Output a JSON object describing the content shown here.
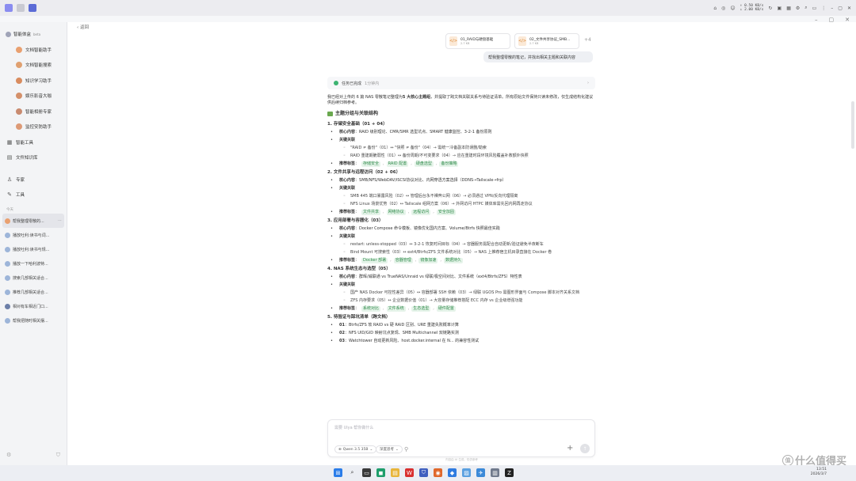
{
  "topbar": {
    "speed_up": "↑ 0.50 KB/s",
    "speed_down": "↓ 2.00 KB/s"
  },
  "sidebar": {
    "app_name": "智能体盒",
    "beta": "beta",
    "agents": [
      {
        "label": "文档智能助手"
      },
      {
        "label": "文档智能搜索"
      },
      {
        "label": "知识学习助手"
      },
      {
        "label": "娱乐影音大咖"
      },
      {
        "label": "智能相册专家"
      },
      {
        "label": "监控安防助手"
      }
    ],
    "tools": [
      {
        "label": "智能工具",
        "icon": "grid-icon"
      },
      {
        "label": "文件知识库",
        "icon": "folder-icon"
      }
    ],
    "more": [
      {
        "label": "专家",
        "icon": "person-icon"
      },
      {
        "label": "工具",
        "icon": "wrench-icon"
      }
    ],
    "history_label": "今天",
    "history": [
      {
        "label": "帮我整理零散的..."
      },
      {
        "label": "播放吐利:读书与词..."
      },
      {
        "label": "播放吐利:读书与规..."
      },
      {
        "label": "播放一下哈利波特..."
      },
      {
        "label": "搜索几部相关适合..."
      },
      {
        "label": "推荐几部相关适合..."
      },
      {
        "label": "相对有车相近门口..."
      },
      {
        "label": "帮我把随时相关摆..."
      }
    ]
  },
  "main": {
    "back_label": "返回",
    "attachments": [
      {
        "name": "01_RAID与硬盘基础",
        "size": "2.7 KB"
      },
      {
        "name": "02_文件共享协议_SMB...",
        "size": "2.7 KB"
      }
    ],
    "attach_more": "+4",
    "user_message": "帮我整理零散的笔记，并找出相关主题和关联内容",
    "task_status": "任务已完成",
    "task_time": "1分钟内",
    "intro_pre": "我已经对上传的 6 篇 NAS 零散笔记整理为",
    "intro_bold": "5 大核心主题组",
    "intro_post": "，并提取了跨文档关联关系与待验证清单。所有原始文件保持只读未修改，仅生成结构化建议供后续归档参考。",
    "section_title": "主题分组与关联结构",
    "groups": [
      {
        "title": "1. 存储安全基础（01 + 04）",
        "core_label": "核心内容",
        "core": "：RAID 级别理论、CMR/SMR 选型坑点、SMART 健康监控、3-2-1 备份原则",
        "rel_label": "关键关联",
        "rels": [
          "\"RAID ≠ 备份\"（01）↔ \"快照 ≠ 备份\"（04）→ 需统一冷备副本防误删/勒索",
          "RAID 重建期脆弱性（01）↔ 备份周期/不可变要求（04）→ 应在重建时段环境风险覆盖补救额外快照"
        ],
        "tags_label": "推荐标签",
        "tags": [
          "存储安全",
          "RAID 配置",
          "硬盘选型",
          "备份策略"
        ]
      },
      {
        "title": "2. 文件共享与远程访问（02 + 06）",
        "core_label": "核心内容",
        "core": "：SMB/NFS/WebDAV/iSCSI协议对比、内网穿透方案选择（DDNS→Tailscale→frp）",
        "rel_label": "关键关联",
        "rels": [
          "SMB 445 端口暴露风险（02）↔ 管理后台永不裸奔公网（06）→ 必须通过 VPN/反向代理隔离",
          "NFS Linux 场景优势（02）↔ Tailscale 组网方案（06）→ 外网访问 HTPC 媒体库需先回内网再走协议"
        ],
        "tags_label": "推荐标签",
        "tags": [
          "文件共享",
          "网络协议",
          "远程访问",
          "安全加固"
        ]
      },
      {
        "title": "3. 应用部署与容器化（03）",
        "core_label": "核心内容",
        "core": "：Docker Compose 命令模板、镜像优化国内方案、Volume/Btrfs 快照最佳实践",
        "rel_label": "关键关联",
        "rels": [
          "restart: unless-stopped（03）↔ 3-2-1 恢复时间目标（04）→ 容器服务需配合自动更新/验证避免半夜断车",
          "Bind Mount 可搜索性（03）↔ ext4/Btrfs/ZFS 文件系统对比（05）→ NAS 上推荐宿主机目录直接在 Docker 卷"
        ],
        "tags_label": "推荐标签",
        "tags": [
          "Docker 部署",
          "容器管理",
          "镜像加速",
          "数据持久"
        ]
      },
      {
        "title": "4. NAS 系统生态与选型（05）",
        "core_label": "核心内容",
        "core": "：群晖/威联通 vs TrueNAS/Unraid vs 绿联/极空间对比、文件系统（ext4/Btrfs/ZFS）特性表",
        "rel_label": "关键关联",
        "rels": [
          "国产 NAS Docker 可控性差异（05）↔ 容器部署 SSH 依赖（03）→ 绿联 UGOS Pro 需图形界面与 Compose 脚本对齐关系文档",
          "ZFS 内存要求（05）↔ 企业数据价值（01）→ 大容量存储推荐搭配 ECC 内存 vs 企业级增强功能"
        ],
        "tags_label": "推荐标签",
        "tags": [
          "系统对比",
          "文件系统",
          "生态选型",
          "硬件配置"
        ]
      }
    ],
    "verify_title": "5. 待验证与踩坑清单（跨文档）",
    "verify_items": [
      {
        "num": "01",
        "text": "：Btrfs/ZFS 软 RAID vs 硬 RAID 区别、URE 重建失败概率计算"
      },
      {
        "num": "02",
        "text": "：NFS UID/GID 映射坑点复现、SMB Multichannel 双链路实测"
      },
      {
        "num": "03",
        "text": "：Watchtower 自动更新风险、host.docker.internal 在 N... 的兼容性测试"
      }
    ],
    "input_placeholder": "需要 Ulya 帮你做什么",
    "model_label": "Qwen 3.5 35B",
    "mode_label": "深度思考",
    "disclaimer": "内容由 AI 生成，仅供参考"
  },
  "taskbar": {
    "time": "13:51",
    "date": "2026/3/7"
  },
  "watermark": {
    "text": "什么值得买",
    "badge": "值"
  }
}
